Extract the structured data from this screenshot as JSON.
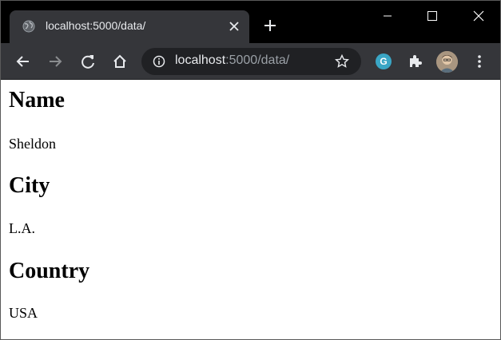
{
  "browser": {
    "tab": {
      "title": "localhost:5000/data/",
      "favicon": "globe-icon"
    },
    "address": {
      "host": "localhost",
      "path": ":5000/data/"
    },
    "extensions": {
      "grammarly_letter": "G"
    },
    "colors": {
      "frame": "#000000",
      "toolbar": "#35363a",
      "omnibox": "#202124",
      "text": "#e8eaed",
      "muted_text": "#9aa0a6",
      "grammarly": "#3aa6c5"
    }
  },
  "page": {
    "sections": [
      {
        "heading": "Name",
        "value": "Sheldon"
      },
      {
        "heading": "City",
        "value": "L.A."
      },
      {
        "heading": "Country",
        "value": "USA"
      }
    ]
  }
}
